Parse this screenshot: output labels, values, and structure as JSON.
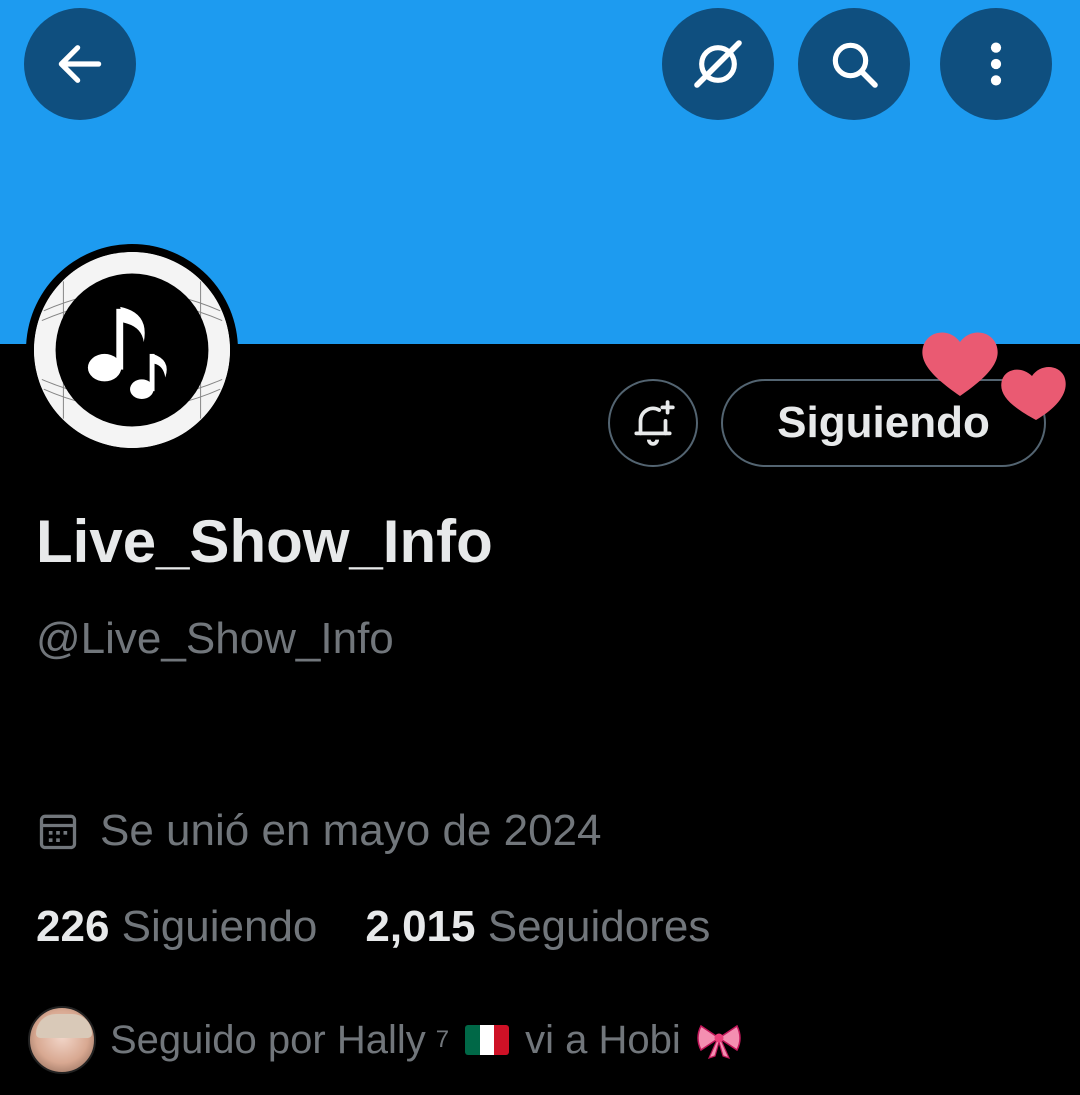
{
  "header": {
    "back_icon": "arrow-left-icon",
    "grok_icon": "grok-slash-icon",
    "search_icon": "search-icon",
    "more_icon": "more-vertical-icon",
    "banner_color": "#1d9bf0"
  },
  "profile": {
    "avatar_icon": "music-notes-icon",
    "display_name": "Live_Show_Info",
    "handle": "@Live_Show_Info",
    "joined": "Se unió en mayo de 2024",
    "following_count": "226",
    "following_label": "Siguiendo",
    "followers_count": "2,015",
    "followers_label": "Seguidores"
  },
  "actions": {
    "notify_icon": "bell-plus-icon",
    "follow_label": "Siguiendo"
  },
  "followed_by": {
    "prefix": "Seguido por Hally",
    "superscript": "7",
    "suffix": "vi a Hobi"
  },
  "colors": {
    "secondary_text": "#71767b",
    "primary_text": "#e7e9ea",
    "heart": "#ea5a72"
  }
}
